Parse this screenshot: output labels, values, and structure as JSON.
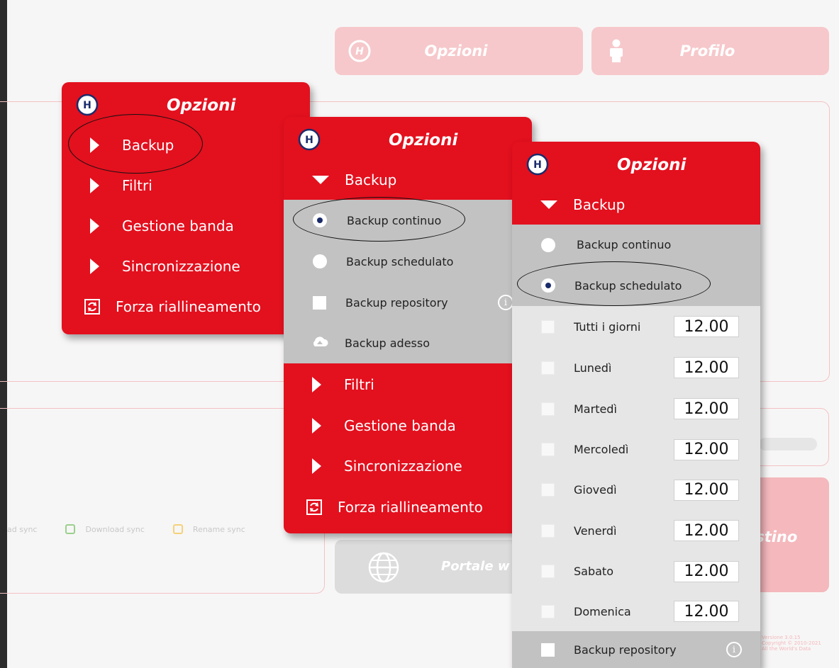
{
  "background": {
    "options_button": "Opzioni",
    "profile_button": "Profilo",
    "portal_button": "Portale w",
    "pink_button_fragment": "istino",
    "legend": [
      "ad sync",
      "Download sync",
      "Rename sync"
    ],
    "version_lines": [
      "Versione 3.0.15",
      "Copyright © 2010-2021",
      "All the World's Data"
    ]
  },
  "menu1": {
    "title": "Opzioni",
    "items": [
      "Backup",
      "Filtri",
      "Gestione banda",
      "Sincronizzazione"
    ],
    "realign": "Forza riallineamento"
  },
  "menu2": {
    "title": "Opzioni",
    "section": "Backup",
    "options": [
      "Backup continuo",
      "Backup schedulato",
      "Backup repository",
      "Backup adesso"
    ],
    "selected": "Backup continuo",
    "items": [
      "Filtri",
      "Gestione banda",
      "Sincronizzazione"
    ],
    "realign": "Forza riallineamento"
  },
  "menu3": {
    "title": "Opzioni",
    "section": "Backup",
    "options": [
      "Backup continuo",
      "Backup schedulato"
    ],
    "selected": "Backup schedulato",
    "days": [
      {
        "label": "Tutti i giorni",
        "time": "12.00"
      },
      {
        "label": "Lunedì",
        "time": "12.00"
      },
      {
        "label": "Martedì",
        "time": "12.00"
      },
      {
        "label": "Mercoledì",
        "time": "12.00"
      },
      {
        "label": "Giovedì",
        "time": "12.00"
      },
      {
        "label": "Venerdì",
        "time": "12.00"
      },
      {
        "label": "Sabato",
        "time": "12.00"
      },
      {
        "label": "Domenica",
        "time": "12.00"
      }
    ],
    "repository": "Backup repository"
  },
  "colors": {
    "brand_red": "#e3101e",
    "pale_pink": "#f6c8cb",
    "navy": "#1a2b6b"
  }
}
